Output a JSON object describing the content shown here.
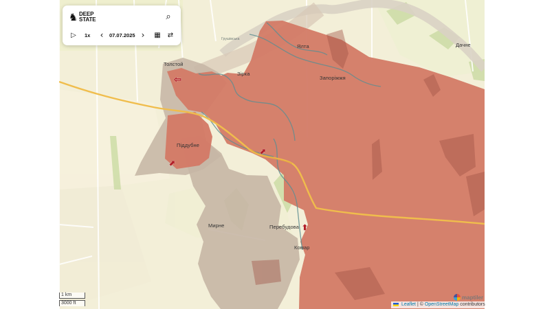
{
  "toolbar": {
    "brand_top": "DEEP",
    "brand_bottom": "STATE",
    "speed": "1x",
    "date": "07.07.2025",
    "icons": {
      "brand": "knight-icon",
      "search": "search-icon",
      "play": "play-icon",
      "previous": "chevron-left-icon",
      "next": "chevron-right-icon",
      "calendar": "calendar-icon",
      "compare": "compare-arrows-icon"
    }
  },
  "map": {
    "colors": {
      "land": "#f3efd8",
      "fields": "#e4e6c7",
      "green": "#c7d99f",
      "occupied": "#d37a66",
      "contested": "#c6b6a5",
      "road_primary": "#f0bd4c",
      "road_secondary": "#ffffff",
      "water": "#5e8d91",
      "front_arrow": "#b21f28"
    },
    "places": [
      {
        "name": "Толстой",
        "kind": "village"
      },
      {
        "name": "Зірка",
        "kind": "village"
      },
      {
        "name": "Ялта",
        "kind": "village"
      },
      {
        "name": "Запоріжжя",
        "kind": "village"
      },
      {
        "name": "Піддубне",
        "kind": "village"
      },
      {
        "name": "Мирне",
        "kind": "village"
      },
      {
        "name": "Перебудова",
        "kind": "village"
      },
      {
        "name": "Комар",
        "kind": "village"
      },
      {
        "name": "Дачне",
        "kind": "village"
      },
      {
        "name": "Грушівська",
        "kind": "street"
      }
    ],
    "markers": [
      {
        "name": "west-arrow-icon",
        "glyph": "⇦"
      },
      {
        "name": "north-east-arrow-icon",
        "glyph": "⬈"
      },
      {
        "name": "north-east-arrow-icon",
        "glyph": "⬈"
      },
      {
        "name": "north-arrow-icon",
        "glyph": "⬆"
      }
    ]
  },
  "scale": {
    "metric": "1 km",
    "imperial": "3000 ft"
  },
  "attribution": {
    "leaflet": "Leaflet",
    "separator": " | © ",
    "osm": "OpenStreetMap",
    "suffix": " contributors",
    "maptiler": "maptiler"
  }
}
